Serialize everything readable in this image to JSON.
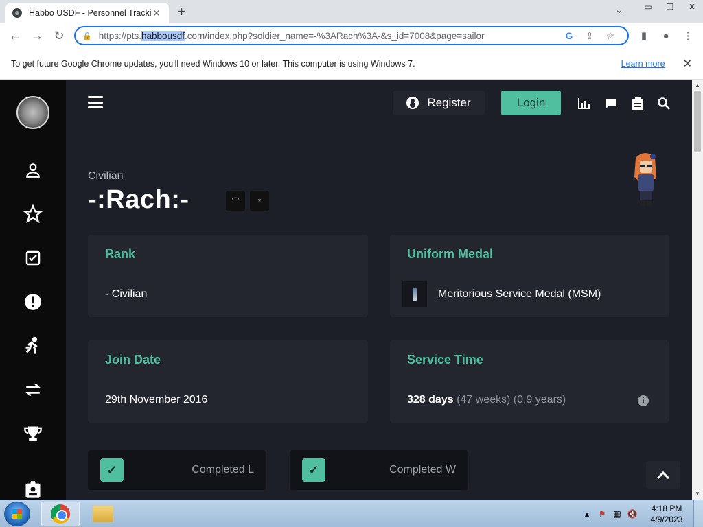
{
  "browser": {
    "tab_title": "Habbo USDF - Personnel Tracking",
    "tab_close": "✕",
    "new_tab": "+",
    "url_before": "https://pts.",
    "url_highlight": "habbousdf",
    "url_after": ".com/index.php?soldier_name=-%3ARach%3A-&s_id=7008&page=sailor",
    "infobar_message": "To get future Google Chrome updates, you'll need Windows 10 or later. This computer is using Windows 7.",
    "infobar_link": "Learn more",
    "infobar_close": "✕"
  },
  "nav": {
    "register_label": "Register",
    "login_label": "Login"
  },
  "profile": {
    "group": "Civilian",
    "name": "-:Rach:-"
  },
  "cards": {
    "rank": {
      "title": "Rank",
      "value": "- Civilian"
    },
    "uniform_medal": {
      "title": "Uniform Medal",
      "value": "Meritorious Service Medal (MSM)"
    },
    "join_date": {
      "title": "Join Date",
      "value": "29th November 2016"
    },
    "service_time": {
      "title": "Service Time",
      "days": "328 days",
      "weeks": "(47 weeks)",
      "years": "(0.9 years)"
    }
  },
  "completed": [
    {
      "label": "Completed L"
    },
    {
      "label": "Completed W"
    }
  ],
  "icons": {
    "sidebar": [
      "user-icon",
      "star-icon",
      "checkbox-icon",
      "alert-icon",
      "running-icon",
      "transfer-icon",
      "trophy-icon",
      "id-badge-icon"
    ],
    "topbar": [
      "chart-icon",
      "comment-icon",
      "clipboard-icon",
      "search-icon"
    ]
  },
  "colors": {
    "accent": "#4fbf9f",
    "sidebar_bg": "#0b0b0b",
    "page_bg": "#1c1f27",
    "card_bg": "#23262e"
  },
  "taskbar": {
    "time": "4:18 PM",
    "date": "4/9/2023"
  }
}
